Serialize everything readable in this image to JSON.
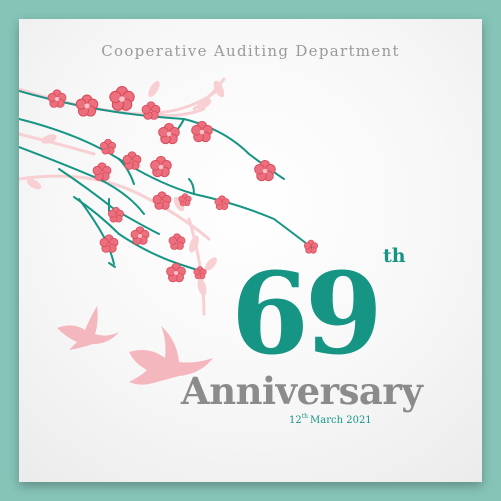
{
  "card": {
    "department": "Cooperative Auditing Department",
    "number": "69",
    "number_suffix": "th",
    "title": "Anniversary",
    "date": {
      "day": "12",
      "day_suffix": "th",
      "rest": "March 2021"
    }
  },
  "colors": {
    "frame": "#86c4b8",
    "accent": "#169585",
    "blossom": "#ec6f7d",
    "blossom_light": "#f7c2c8",
    "text_gray": "#8b8b8b"
  },
  "icons": [
    "cherry-blossom-branch-icon",
    "swallow-bird-icon"
  ]
}
